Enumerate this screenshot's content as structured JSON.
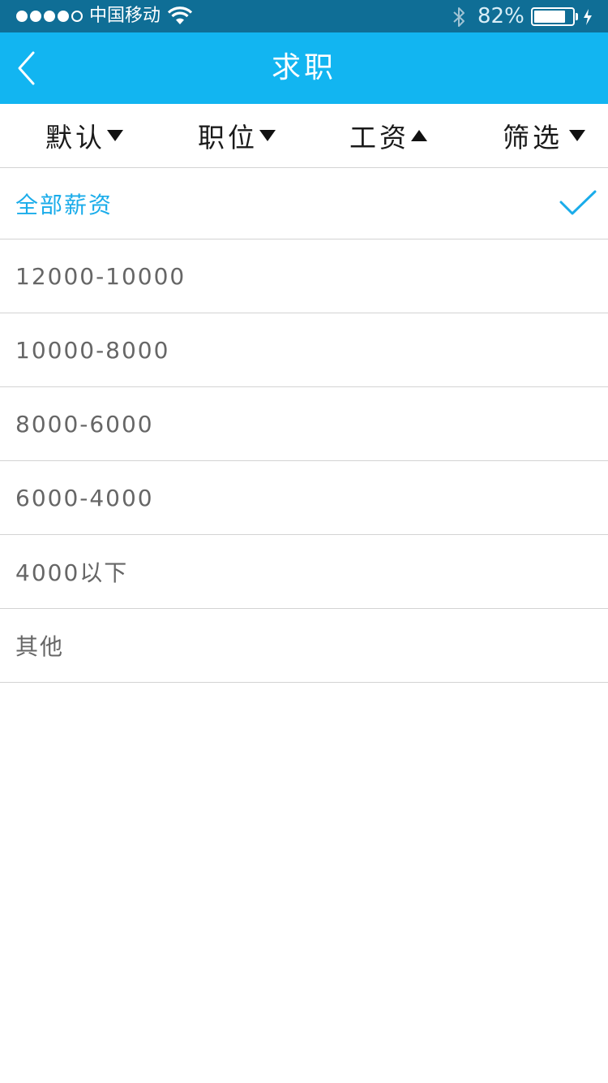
{
  "status_bar": {
    "carrier": "中国移动",
    "battery_percent_text": "82%",
    "battery_level": 0.82,
    "icons": [
      "signal-dots",
      "wifi-icon",
      "bluetooth-icon",
      "battery-icon",
      "charging-bolt-icon"
    ]
  },
  "nav": {
    "title": "求职",
    "back_icon": "chevron-left-icon"
  },
  "filters": [
    {
      "label": "默认",
      "arrow": "down"
    },
    {
      "label": "职位",
      "arrow": "down"
    },
    {
      "label": "工资",
      "arrow": "up"
    },
    {
      "label": "筛选",
      "arrow": "down"
    }
  ],
  "salary_options": [
    {
      "label": "全部薪资",
      "selected": true
    },
    {
      "label": "12000-10000",
      "selected": false
    },
    {
      "label": "10000-8000",
      "selected": false
    },
    {
      "label": "8000-6000",
      "selected": false
    },
    {
      "label": "6000-4000",
      "selected": false
    },
    {
      "label": "4000以下",
      "selected": false
    },
    {
      "label": "其他",
      "selected": false
    }
  ],
  "colors": {
    "status_bar_bg": "#0f6e96",
    "nav_bg": "#12b5f1",
    "accent": "#1aacea",
    "row_text": "#666666",
    "divider": "#d3d3d3"
  }
}
